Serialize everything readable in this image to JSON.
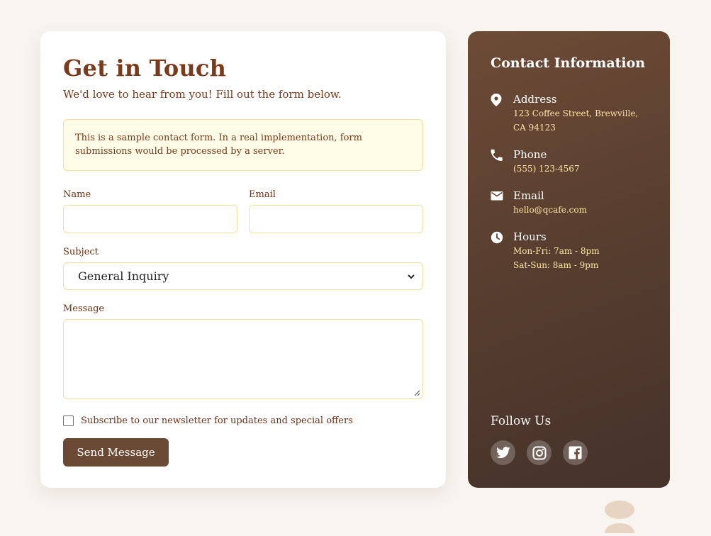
{
  "form": {
    "title": "Get in Touch",
    "subtitle": "We'd love to hear from you! Fill out the form below.",
    "notice": "This is a sample contact form. In a real implementation, form submissions would be processed by a server.",
    "name_label": "Name",
    "name_value": "",
    "email_label": "Email",
    "email_value": "",
    "subject_label": "Subject",
    "subject_selected": "General Inquiry",
    "message_label": "Message",
    "message_value": "",
    "newsletter_label": "Subscribe to our newsletter for updates and special offers",
    "newsletter_checked": false,
    "submit_label": "Send Message"
  },
  "info": {
    "title": "Contact Information",
    "items": [
      {
        "icon": "location-pin-icon",
        "label": "Address",
        "lines": [
          "123 Coffee Street, Brewville,",
          "CA 94123"
        ]
      },
      {
        "icon": "phone-icon",
        "label": "Phone",
        "lines": [
          "(555) 123-4567"
        ]
      },
      {
        "icon": "mail-icon",
        "label": "Email",
        "lines": [
          "hello@qcafe.com"
        ]
      },
      {
        "icon": "clock-icon",
        "label": "Hours",
        "lines": [
          "Mon-Fri: 7am - 8pm",
          "Sat-Sun: 8am - 9pm"
        ]
      }
    ],
    "follow_title": "Follow Us",
    "socials": [
      "twitter-icon",
      "instagram-icon",
      "facebook-icon"
    ]
  },
  "colors": {
    "accent": "#7a3a1c",
    "button": "#6b4a35",
    "highlight": "#fce5a2",
    "page_bg": "#f8f4ef"
  }
}
